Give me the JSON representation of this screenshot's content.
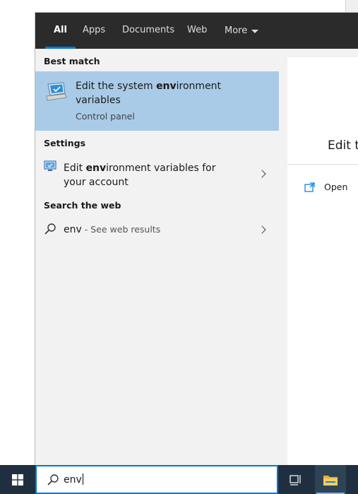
{
  "tabs": [
    {
      "label": "All"
    },
    {
      "label": "Apps"
    },
    {
      "label": "Documents"
    },
    {
      "label": "Web"
    },
    {
      "label": "More"
    }
  ],
  "sections": {
    "best_match": "Best match",
    "settings": "Settings",
    "search_web": "Search the web"
  },
  "best_match": {
    "title_before": "Edit the system ",
    "title_highlight": "env",
    "title_after": "ironment variables",
    "subtitle": "Control panel",
    "icon": "system-properties-icon"
  },
  "settings_item": {
    "text_before": "Edit ",
    "text_highlight": "env",
    "text_after": "ironment variables for your account",
    "icon": "monitor-settings-icon"
  },
  "web_item": {
    "query": "env",
    "suffix": " - See web results",
    "icon": "search-icon"
  },
  "detail": {
    "title": "Edit t",
    "open_label": "Open",
    "open_icon": "open-external-icon"
  },
  "taskbar": {
    "search_value": "env",
    "accent_color": "#0078d7",
    "background_color": "#1f2f3f"
  }
}
